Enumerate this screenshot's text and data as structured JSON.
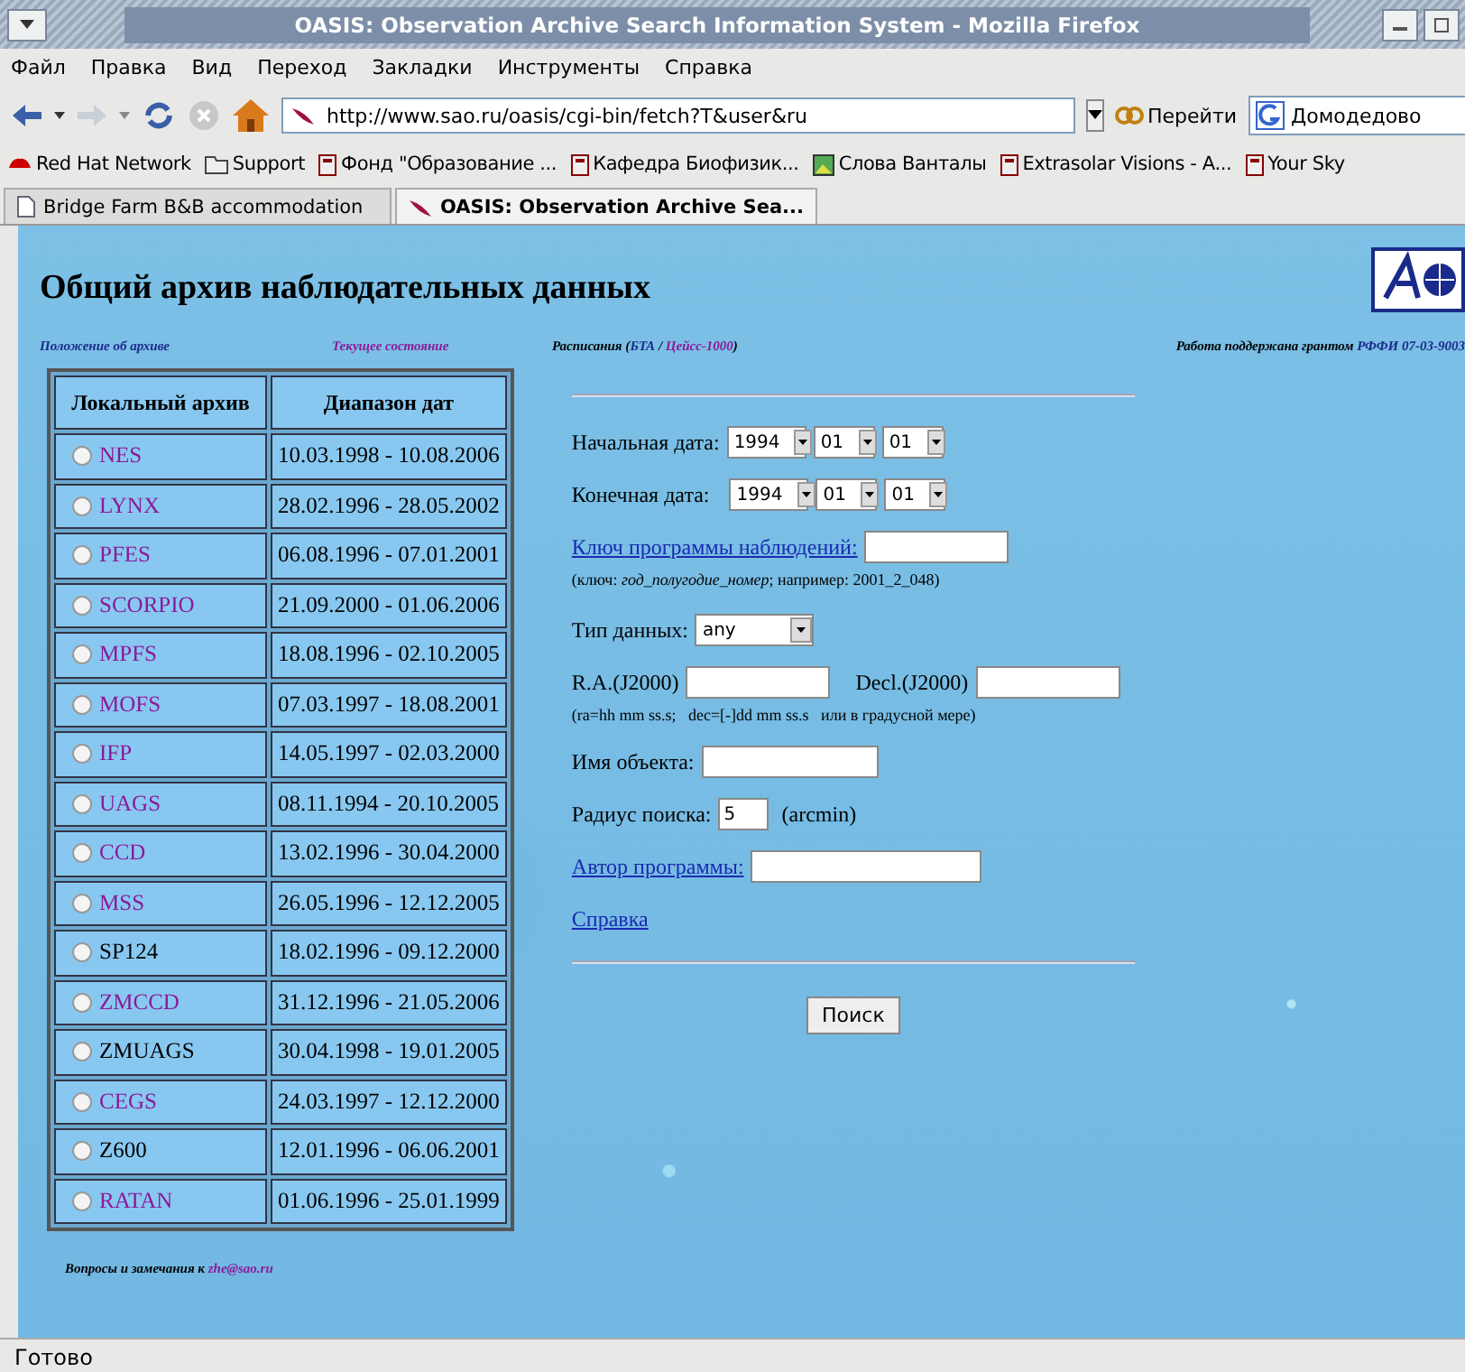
{
  "window": {
    "title": "OASIS: Observation Archive Search Information System - Mozilla Firefox"
  },
  "menu": [
    "Файл",
    "Правка",
    "Вид",
    "Переход",
    "Закладки",
    "Инструменты",
    "Справка"
  ],
  "toolbar": {
    "url": "http://www.sao.ru/oasis/cgi-bin/fetch?T&user&ru",
    "go": "Перейти",
    "search": "Домодедово"
  },
  "bookmarks": [
    {
      "label": "Red Hat Network",
      "kind": "redhat"
    },
    {
      "label": "Support",
      "kind": "folder"
    },
    {
      "label": "Фонд \"Образование ...",
      "kind": "book"
    },
    {
      "label": "Кафедра Биофизик...",
      "kind": "book"
    },
    {
      "label": "Слова Ванталы",
      "kind": "image"
    },
    {
      "label": "Extrasolar Visions - A...",
      "kind": "book"
    },
    {
      "label": "Your Sky",
      "kind": "book"
    }
  ],
  "tabs": [
    {
      "label": "Bridge Farm B&B accommodation",
      "selected": false
    },
    {
      "label": "OASIS: Observation Archive Sea...",
      "selected": true
    }
  ],
  "page": {
    "heading": "Общий архив наблюдательных данных",
    "top_links": {
      "regulations": "Положение об архиве",
      "status": "Текущее состояние",
      "schedules_label": "Расписания (",
      "schedule_bta": "БТА",
      "schedule_sep": "/",
      "schedule_zeiss": "Цейсс-1000",
      "schedules_end": ")",
      "grant_label": "Работа поддержана грантом",
      "grant_link": "РФФИ 07-03-9003"
    },
    "archive_table": {
      "columns": [
        "Локальный архив",
        "Диапазон дат"
      ],
      "rows": [
        {
          "name": "NES",
          "linked": true,
          "selected": false,
          "range": "10.03.1998 - 10.08.2006"
        },
        {
          "name": "LYNX",
          "linked": true,
          "selected": false,
          "range": "28.02.1996 - 28.05.2002"
        },
        {
          "name": "PFES",
          "linked": true,
          "selected": false,
          "range": "06.08.1996 - 07.01.2001"
        },
        {
          "name": "SCORPIO",
          "linked": true,
          "selected": false,
          "range": "21.09.2000 - 01.06.2006"
        },
        {
          "name": "MPFS",
          "linked": true,
          "selected": false,
          "range": "18.08.1996 - 02.10.2005"
        },
        {
          "name": "MOFS",
          "linked": true,
          "selected": false,
          "range": "07.03.1997 - 18.08.2001"
        },
        {
          "name": "IFP",
          "linked": true,
          "selected": false,
          "range": "14.05.1997 - 02.03.2000"
        },
        {
          "name": "UAGS",
          "linked": true,
          "selected": false,
          "range": "08.11.1994 - 20.10.2005"
        },
        {
          "name": "CCD",
          "linked": true,
          "selected": false,
          "range": "13.02.1996 - 30.04.2000"
        },
        {
          "name": "MSS",
          "linked": true,
          "selected": false,
          "range": "26.05.1996 - 12.12.2005"
        },
        {
          "name": "SP124",
          "linked": false,
          "selected": false,
          "range": "18.02.1996 - 09.12.2000"
        },
        {
          "name": "ZMCCD",
          "linked": true,
          "selected": false,
          "range": "31.12.1996 - 21.05.2006"
        },
        {
          "name": "ZMUAGS",
          "linked": false,
          "selected": false,
          "range": "30.04.1998 - 19.01.2005"
        },
        {
          "name": "CEGS",
          "linked": true,
          "selected": false,
          "range": "24.03.1997 - 12.12.2000"
        },
        {
          "name": "Z600",
          "linked": false,
          "selected": false,
          "range": "12.01.1996 - 06.06.2001"
        },
        {
          "name": "RATAN",
          "linked": true,
          "selected": false,
          "range": "01.06.1996 - 25.01.1999"
        }
      ]
    },
    "footer_label": "Вопросы и замечания к",
    "footer_email": "zhe@sao.ru",
    "form": {
      "start_label": "Начальная дата:",
      "start": [
        "1994",
        "01",
        "01"
      ],
      "end_label": "Конечная дата:",
      "end": [
        "1994",
        "01",
        "01"
      ],
      "key_link": "Ключ программы наблюдений:",
      "key_hint": "(ключ: *год_полугодие_номер*; например: 2001_2_048)",
      "type_label": "Тип данных:",
      "type_value": "any",
      "ra_label": "R.A.(J2000)",
      "dec_label": "Decl.(J2000)",
      "coord_hint": "(ra=hh mm ss.s;   dec=[-]dd mm ss.s   или в градусной мере)",
      "object_label": "Имя объекта:",
      "radius_label": "Радиус поиска:",
      "radius_value": "5",
      "radius_unit": "(arcmin)",
      "author_link": "Автор программы:",
      "help_link": "Справка",
      "search_button": "Поиск"
    }
  },
  "status_bar": "Готово"
}
